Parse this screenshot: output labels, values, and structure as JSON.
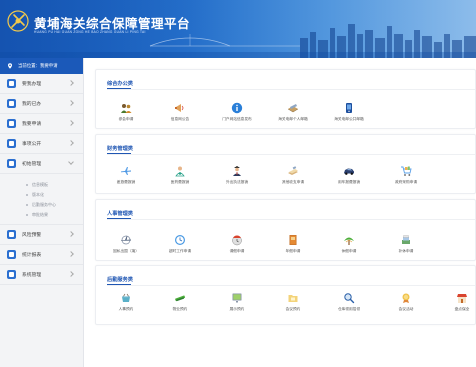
{
  "header": {
    "title": "黄埔海关综合保障管理平台",
    "subtitle": "HUANG PU HAI GUAN ZONG HE BAO ZHANG GUAN LI PING TAI"
  },
  "sidebar": {
    "location": "当前位置：我要申请",
    "items": [
      {
        "label": "要我办理"
      },
      {
        "label": "我的已办"
      },
      {
        "label": "我要申请"
      },
      {
        "label": "事项公开"
      },
      {
        "label": "初始管理"
      },
      {
        "label": "风险预警"
      },
      {
        "label": "统计报表"
      },
      {
        "label": "系统管理"
      }
    ],
    "subitems": [
      "信息模板",
      "版本化",
      "后勤服务中心",
      "审批结果"
    ]
  },
  "sections": [
    {
      "title": "综合办公类",
      "apps": [
        {
          "label": "参会申请",
          "icon": "people-icon"
        },
        {
          "label": "信息网公告",
          "icon": "megaphone-icon"
        },
        {
          "label": "门户网站信息发布",
          "icon": "info-icon"
        },
        {
          "label": "海关电邮个人邮箱",
          "icon": "mail-icon"
        },
        {
          "label": "海关电邮公共邮箱",
          "icon": "phone-icon"
        }
      ]
    },
    {
      "title": "财务管理类",
      "apps": [
        {
          "label": "差旅费报销",
          "icon": "airplane-icon"
        },
        {
          "label": "医药费报销",
          "icon": "medical-icon"
        },
        {
          "label": "外出执法报销",
          "icon": "officer-icon"
        },
        {
          "label": "其他收支申请",
          "icon": "document-icon"
        },
        {
          "label": "用车报费报销",
          "icon": "car-icon"
        },
        {
          "label": "政府采购申请",
          "icon": "cart-icon"
        }
      ]
    },
    {
      "title": "人事管理类",
      "apps": [
        {
          "label": "因私出国（境）",
          "icon": "plane-globe-icon"
        },
        {
          "label": "超时工作申请",
          "icon": "clock-icon"
        },
        {
          "label": "请假申请",
          "icon": "calendar-clock-icon"
        },
        {
          "label": "年假申请",
          "icon": "book-icon"
        },
        {
          "label": "休假申请",
          "icon": "tree-icon"
        },
        {
          "label": "补休申请",
          "icon": "stack-icon"
        }
      ]
    },
    {
      "title": "后勤服务类",
      "apps": [
        {
          "label": "人事预约",
          "icon": "basket-icon"
        },
        {
          "label": "物业预约",
          "icon": "wrench-icon"
        },
        {
          "label": "展示预约",
          "icon": "monitor-icon"
        },
        {
          "label": "会议预约",
          "icon": "folder-icon"
        },
        {
          "label": "仓库领用招领",
          "icon": "magnifier-icon"
        },
        {
          "label": "会议活动",
          "icon": "badge-icon"
        },
        {
          "label": "盘点保全",
          "icon": "shop-icon"
        }
      ]
    }
  ],
  "colors": {
    "brand": "#1b59b9",
    "section_title": "#1f56b3"
  }
}
